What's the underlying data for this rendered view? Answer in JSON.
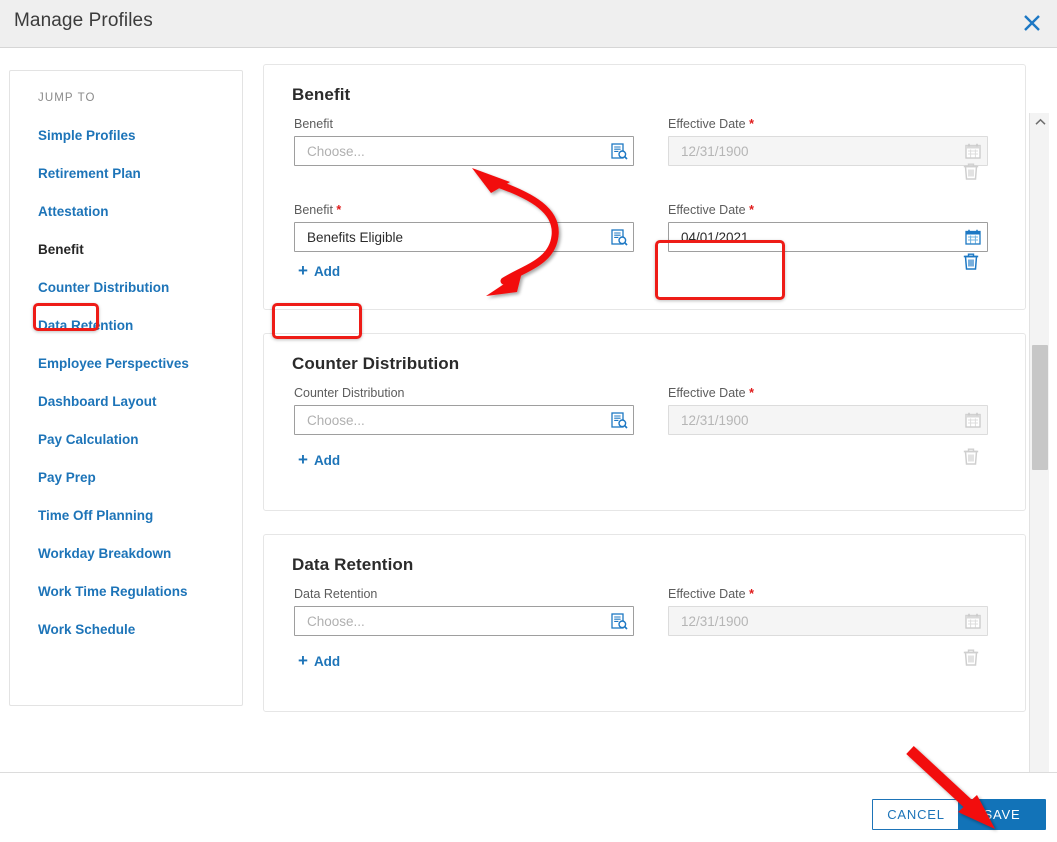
{
  "window": {
    "title": "Manage Profiles",
    "close_icon": "close-icon"
  },
  "sidebar": {
    "heading": "JUMP TO",
    "items": [
      {
        "label": "Simple Profiles",
        "active": false
      },
      {
        "label": "Retirement Plan",
        "active": false
      },
      {
        "label": "Attestation",
        "active": false
      },
      {
        "label": "Benefit",
        "active": true
      },
      {
        "label": "Counter Distribution",
        "active": false
      },
      {
        "label": "Data Retention",
        "active": false
      },
      {
        "label": "Employee Perspectives",
        "active": false
      },
      {
        "label": "Dashboard Layout",
        "active": false
      },
      {
        "label": "Pay Calculation",
        "active": false
      },
      {
        "label": "Pay Prep",
        "active": false
      },
      {
        "label": "Time Off Planning",
        "active": false
      },
      {
        "label": "Workday Breakdown",
        "active": false
      },
      {
        "label": "Work Time Regulations",
        "active": false
      },
      {
        "label": "Work Schedule",
        "active": false
      }
    ]
  },
  "sections": {
    "benefit": {
      "title": "Benefit",
      "rows": [
        {
          "name_label": "Benefit",
          "name_required": false,
          "name_value": "",
          "name_placeholder": "Choose...",
          "date_label": "Effective Date",
          "date_required": true,
          "date_value": "",
          "date_placeholder": "12/31/1900",
          "disabled": true
        },
        {
          "name_label": "Benefit",
          "name_required": true,
          "name_value": "Benefits Eligible",
          "name_placeholder": "Choose...",
          "date_label": "Effective Date",
          "date_required": true,
          "date_value": "04/01/2021",
          "date_placeholder": "",
          "disabled": false
        }
      ],
      "add_label": "Add"
    },
    "counter_distribution": {
      "title": "Counter Distribution",
      "rows": [
        {
          "name_label": "Counter Distribution",
          "name_required": false,
          "name_value": "",
          "name_placeholder": "Choose...",
          "date_label": "Effective Date",
          "date_required": true,
          "date_value": "",
          "date_placeholder": "12/31/1900",
          "disabled": true
        }
      ],
      "add_label": "Add"
    },
    "data_retention": {
      "title": "Data Retention",
      "rows": [
        {
          "name_label": "Data Retention",
          "name_required": false,
          "name_value": "",
          "name_placeholder": "Choose...",
          "date_label": "Effective Date",
          "date_required": true,
          "date_value": "",
          "date_placeholder": "12/31/1900",
          "disabled": true
        }
      ],
      "add_label": "Add"
    }
  },
  "icons": {
    "lookup": "prompt-lookup-icon",
    "calendar": "calendar-icon",
    "trash": "trash-icon",
    "plus": "+"
  },
  "footer": {
    "cancel_label": "CANCEL",
    "save_label": "SAVE"
  },
  "colors": {
    "accent_blue": "#1d74b8",
    "save_blue": "#1273b8",
    "annotation_red": "#ee1c17",
    "required_red": "#e01b1b",
    "header_gray": "#efefef"
  },
  "annotations": {
    "highlight_benefit_nav": "red box around Benefit nav item",
    "highlight_effective_date": "red box around Effective Date field",
    "highlight_add": "red box around Add button",
    "arrow_curved": "double-headed curved arrow from Benefit choose field to Benefits Eligible field",
    "arrow_save": "red arrow pointing to SAVE button"
  }
}
